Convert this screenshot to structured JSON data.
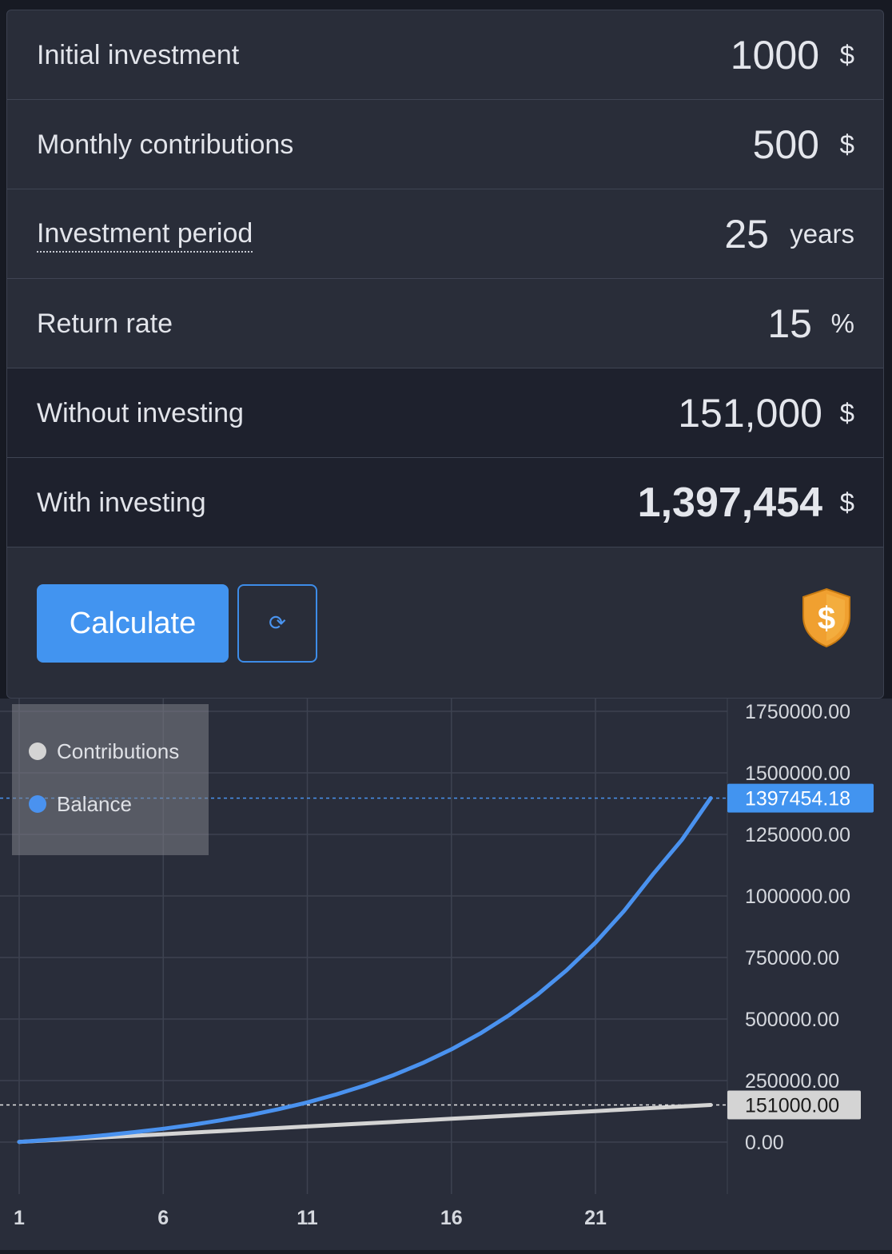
{
  "form": {
    "initial": {
      "label": "Initial investment",
      "value": "1000",
      "unit": "$"
    },
    "monthly": {
      "label": "Monthly contributions",
      "value": "500",
      "unit": "$"
    },
    "period": {
      "label": "Investment period",
      "value": "25",
      "unit": "years"
    },
    "rate": {
      "label": "Return rate",
      "value": "15",
      "unit": "%"
    },
    "without": {
      "label": "Without investing",
      "value": "151,000",
      "unit": "$"
    },
    "with": {
      "label": "With investing",
      "value": "1,397,454",
      "unit": "$"
    }
  },
  "actions": {
    "calculate_label": "Calculate",
    "reset_glyph": "⟳",
    "shield_glyph": "$"
  },
  "colors": {
    "accent": "#4294f0",
    "balance": "#4a92ef",
    "contributions": "#d4d4d4",
    "shield": "#f0a030"
  },
  "chart_data": {
    "type": "line",
    "x": [
      1,
      2,
      3,
      4,
      5,
      6,
      7,
      8,
      9,
      10,
      11,
      12,
      13,
      14,
      15,
      16,
      17,
      18,
      19,
      20,
      21,
      22,
      23,
      24,
      25
    ],
    "x_ticks": [
      1,
      6,
      11,
      16,
      21
    ],
    "ylim": [
      0,
      1750000
    ],
    "y_ticks": [
      "0.00",
      "250000.00",
      "500000.00",
      "750000.00",
      "1000000.00",
      "1250000.00",
      "1500000.00",
      "1750000.00"
    ],
    "y_tick_values": [
      0,
      250000,
      500000,
      750000,
      1000000,
      1250000,
      1500000,
      1750000
    ],
    "legend_position": "top-left",
    "grid": true,
    "series": [
      {
        "name": "Contributions",
        "values": [
          1000,
          7250,
          13500,
          19750,
          26000,
          32250,
          38500,
          44750,
          51000,
          57250,
          63500,
          69750,
          76000,
          82250,
          88500,
          94750,
          101000,
          107250,
          113500,
          119750,
          126000,
          132250,
          138500,
          144750,
          151000
        ],
        "last_label": "151000.00"
      },
      {
        "name": "Balance",
        "values": [
          1000,
          8900,
          18000,
          28500,
          40500,
          54300,
          70200,
          88500,
          109500,
          133700,
          161400,
          193400,
          230100,
          272400,
          321100,
          377000,
          441300,
          515300,
          600300,
          698100,
          810500,
          939800,
          1088500,
          1228000,
          1397454.18
        ],
        "last_label": "1397454.18"
      }
    ]
  }
}
